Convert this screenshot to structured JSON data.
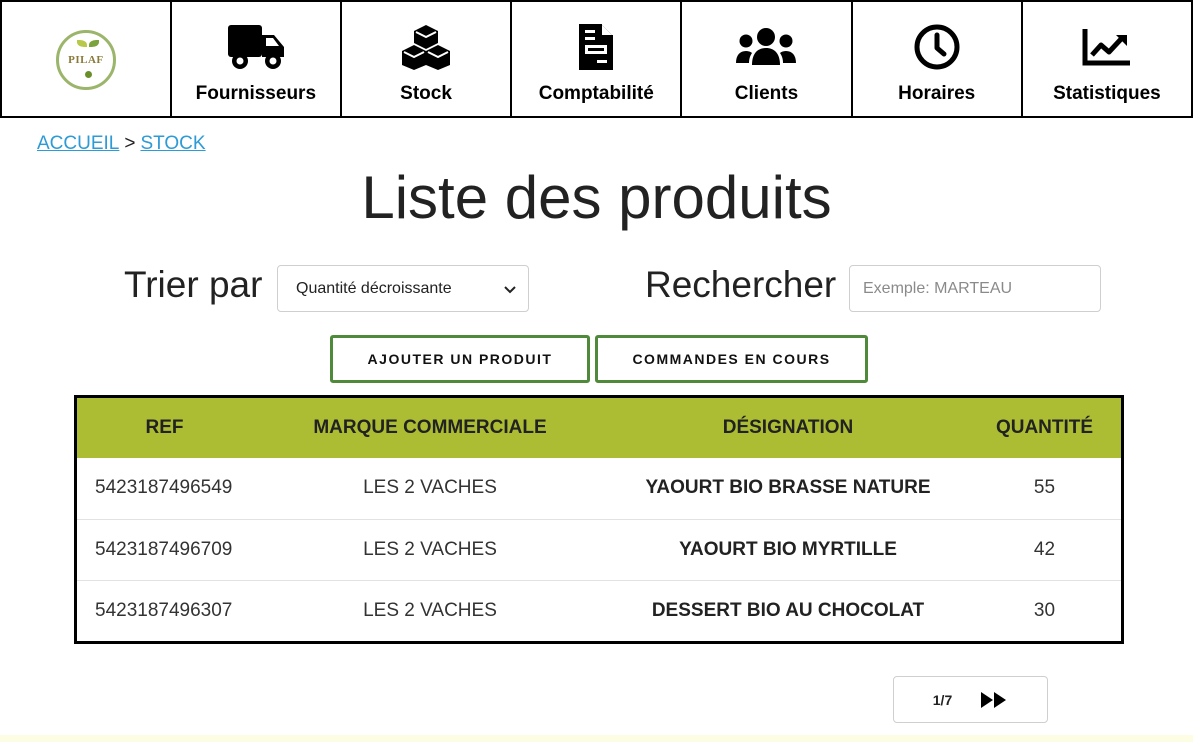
{
  "nav": {
    "logo_text": "PILAF",
    "items": [
      {
        "label": "Fournisseurs",
        "icon": "truck-icon"
      },
      {
        "label": "Stock",
        "icon": "cubes-icon"
      },
      {
        "label": "Comptabilité",
        "icon": "document-icon"
      },
      {
        "label": "Clients",
        "icon": "users-icon"
      },
      {
        "label": "Horaires",
        "icon": "clock-icon"
      },
      {
        "label": "Statistiques",
        "icon": "chart-line-icon"
      }
    ]
  },
  "breadcrumb": {
    "home": "ACCUEIL",
    "separator": ">",
    "current": "STOCK"
  },
  "page_title": "Liste des produits",
  "sort": {
    "label": "Trier par",
    "selected": "Quantité décroissante"
  },
  "search": {
    "label": "Rechercher",
    "placeholder": "Exemple: MARTEAU",
    "value": ""
  },
  "actions": {
    "add_product": "AJOUTER UN PRODUIT",
    "pending_orders": "COMMANDES EN COURS"
  },
  "table": {
    "headers": [
      "REF",
      "MARQUE COMMERCIALE",
      "DÉSIGNATION",
      "QUANTITÉ"
    ],
    "rows": [
      {
        "ref": "5423187496549",
        "marque": "LES 2 VACHES",
        "designation": "YAOURT BIO BRASSE NATURE",
        "quantite": "55"
      },
      {
        "ref": "5423187496709",
        "marque": "LES 2 VACHES",
        "designation": "YAOURT BIO MYRTILLE",
        "quantite": "42"
      },
      {
        "ref": "5423187496307",
        "marque": "LES 2 VACHES",
        "designation": "DESSERT BIO AU CHOCOLAT",
        "quantite": "30"
      }
    ]
  },
  "pagination": {
    "page": "1/7",
    "next_icon": "fast-forward-icon"
  },
  "colors": {
    "header_bg": "#acbd33",
    "button_border": "#4e8a3a",
    "link": "#2c9bd6"
  }
}
